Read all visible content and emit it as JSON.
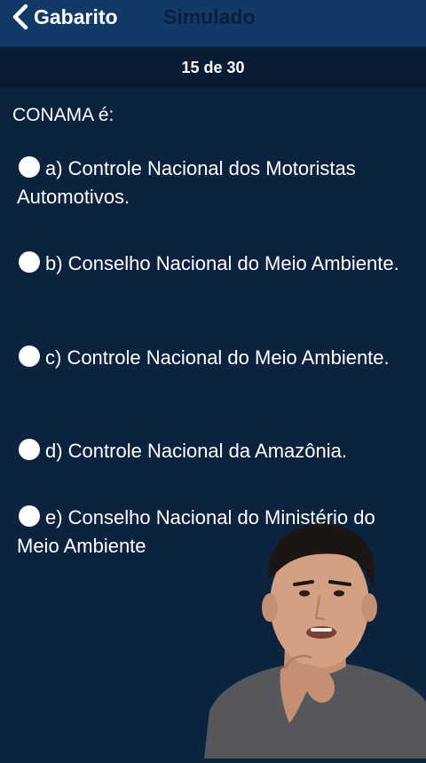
{
  "navbar": {
    "back_label": "Gabarito",
    "title": "Simulado"
  },
  "progress": {
    "text": "15 de 30"
  },
  "question": {
    "text": "CONAMA é:"
  },
  "options": [
    {
      "text": "a) Controle Nacional dos Motoristas Automotivos."
    },
    {
      "text": "b) Conselho Nacional do Meio Ambiente."
    },
    {
      "text": "c) Controle Nacional do Meio Ambiente."
    },
    {
      "text": "d) Controle Nacional da Amazônia."
    },
    {
      "text": "e) Conselho Nacional do Ministério do Meio Ambiente"
    }
  ],
  "colors": {
    "background": "#0c2340",
    "navbar": "#123a66",
    "progress_bar": "#0a1c33",
    "title": "#081f3f",
    "text": "#ffffff"
  },
  "icons": {
    "back": "chevron-left-icon",
    "radio": "radio-unselected-icon"
  }
}
